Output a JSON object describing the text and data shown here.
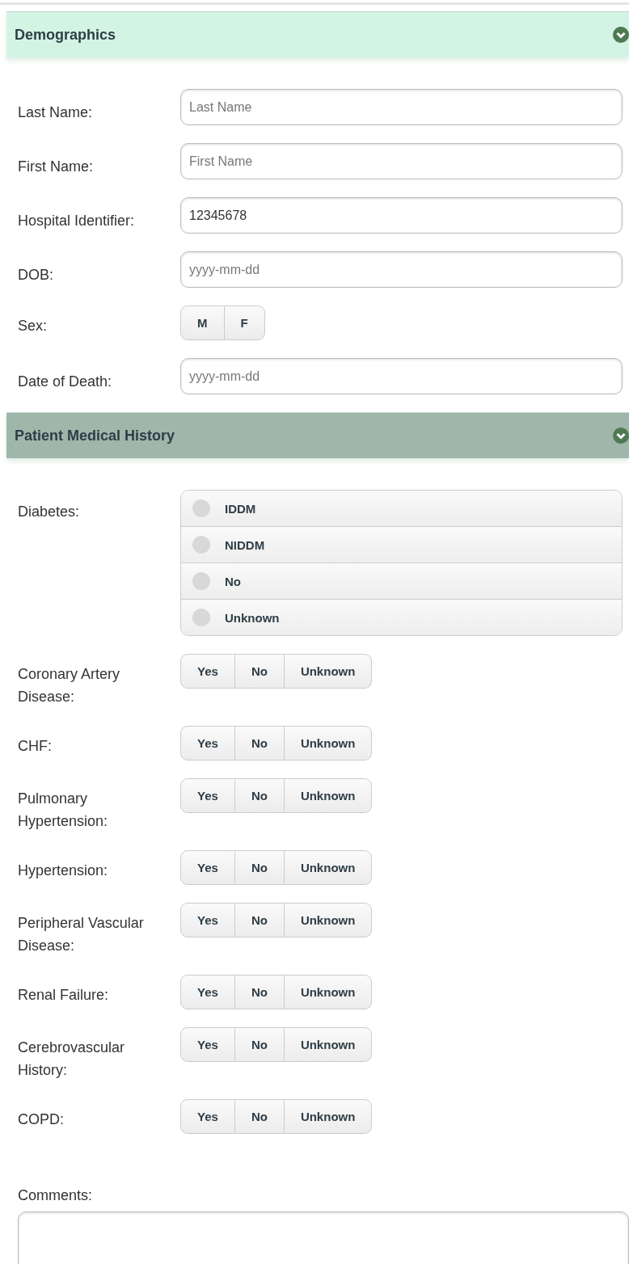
{
  "sections": [
    {
      "title": "Demographics",
      "active": true,
      "fields": [
        {
          "kind": "text",
          "label": "Last Name:",
          "placeholder": "Last Name"
        },
        {
          "kind": "text",
          "label": "First Name:",
          "placeholder": "First Name"
        },
        {
          "kind": "text",
          "label": "Hospital Identifier:",
          "value": "12345678"
        },
        {
          "kind": "text",
          "label": "DOB:",
          "placeholder": "yyyy-mm-dd"
        },
        {
          "kind": "segmented",
          "label": "Sex:",
          "options": [
            {
              "label": "M",
              "selected": false
            },
            {
              "label": "F",
              "selected": false
            }
          ]
        },
        {
          "kind": "text",
          "label": "Date of Death:",
          "placeholder": "yyyy-mm-dd"
        }
      ]
    },
    {
      "title": "Patient Medical History",
      "active": false,
      "fields": [
        {
          "kind": "radio",
          "label": "Diabetes:",
          "options": [
            {
              "label": "IDDM",
              "checked": false
            },
            {
              "label": "NIDDM",
              "checked": false
            },
            {
              "label": "No",
              "checked": false
            },
            {
              "label": "Unknown",
              "checked": false
            }
          ]
        },
        {
          "kind": "segmented",
          "label": "Coronary Artery Disease:",
          "options": [
            {
              "label": "Yes",
              "selected": false
            },
            {
              "label": "No",
              "selected": false
            },
            {
              "label": "Unknown",
              "selected": false
            }
          ]
        },
        {
          "kind": "segmented",
          "label": "CHF:",
          "options": [
            {
              "label": "Yes",
              "selected": false
            },
            {
              "label": "No",
              "selected": false
            },
            {
              "label": "Unknown",
              "selected": false
            }
          ]
        },
        {
          "kind": "segmented",
          "label": "Pulmonary Hypertension:",
          "options": [
            {
              "label": "Yes",
              "selected": false
            },
            {
              "label": "No",
              "selected": false
            },
            {
              "label": "Unknown",
              "selected": false
            }
          ]
        },
        {
          "kind": "segmented",
          "label": "Hypertension:",
          "options": [
            {
              "label": "Yes",
              "selected": false
            },
            {
              "label": "No",
              "selected": false
            },
            {
              "label": "Unknown",
              "selected": false
            }
          ]
        },
        {
          "kind": "segmented",
          "label": "Peripheral Vascular Disease:",
          "options": [
            {
              "label": "Yes",
              "selected": false
            },
            {
              "label": "No",
              "selected": false
            },
            {
              "label": "Unknown",
              "selected": false
            }
          ]
        },
        {
          "kind": "segmented",
          "label": "Renal Failure:",
          "options": [
            {
              "label": "Yes",
              "selected": false
            },
            {
              "label": "No",
              "selected": false
            },
            {
              "label": "Unknown",
              "selected": false
            }
          ]
        },
        {
          "kind": "segmented",
          "label": "Cerebrovascular History:",
          "options": [
            {
              "label": "Yes",
              "selected": false
            },
            {
              "label": "No",
              "selected": false
            },
            {
              "label": "Unknown",
              "selected": false
            }
          ]
        },
        {
          "kind": "segmented",
          "label": "COPD:",
          "options": [
            {
              "label": "Yes",
              "selected": false
            },
            {
              "label": "No",
              "selected": false
            },
            {
              "label": "Unknown",
              "selected": false
            }
          ]
        },
        {
          "kind": "textarea",
          "label": "Comments:"
        }
      ]
    }
  ]
}
